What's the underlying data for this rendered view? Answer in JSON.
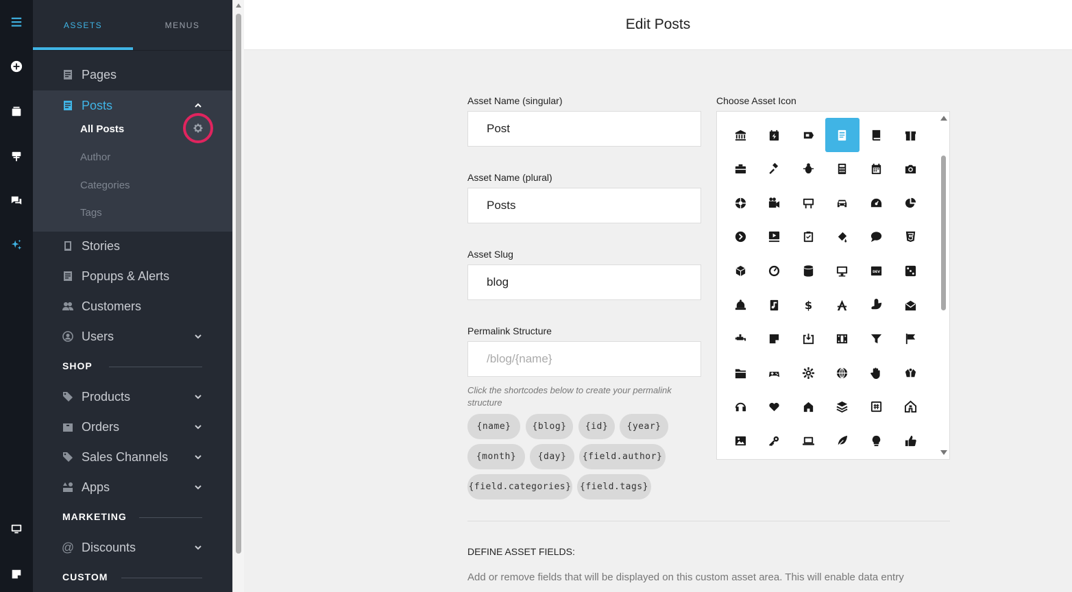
{
  "rail": {
    "items": [
      {
        "name": "menu-icon"
      },
      {
        "name": "add-icon"
      },
      {
        "name": "pages-icon"
      },
      {
        "name": "design-icon"
      },
      {
        "name": "chat-icon"
      },
      {
        "name": "magic-icon"
      },
      {
        "name": "desktop-icon"
      },
      {
        "name": "note-icon"
      }
    ],
    "accent": "#40b4e5"
  },
  "sidebar": {
    "tabs": [
      {
        "label": "ASSETS",
        "active": true
      },
      {
        "label": "MENUS",
        "active": false
      }
    ],
    "items": [
      {
        "label": "Pages",
        "icon": "page-icon"
      },
      {
        "label": "Posts",
        "icon": "post-icon",
        "active": true
      },
      {
        "label": "Stories",
        "icon": "story-icon"
      },
      {
        "label": "Popups & Alerts",
        "icon": "popup-icon"
      },
      {
        "label": "Customers",
        "icon": "customers-icon"
      },
      {
        "label": "Users",
        "icon": "user-icon"
      },
      {
        "label": "Products",
        "icon": "tag-icon"
      },
      {
        "label": "Orders",
        "icon": "box-icon"
      },
      {
        "label": "Sales Channels",
        "icon": "tag-icon"
      },
      {
        "label": "Apps",
        "icon": "apps-icon"
      },
      {
        "label": "Discounts",
        "icon": "at-icon"
      }
    ],
    "posts_sub": [
      {
        "label": "All Posts",
        "active": true
      },
      {
        "label": "Author"
      },
      {
        "label": "Categories"
      },
      {
        "label": "Tags"
      }
    ],
    "sections": {
      "shop": "SHOP",
      "marketing": "MARKETING",
      "custom": "CUSTOM"
    }
  },
  "header": {
    "title": "Edit Posts"
  },
  "form": {
    "singular_label": "Asset Name (singular)",
    "singular_value": "Post",
    "plural_label": "Asset Name (plural)",
    "plural_value": "Posts",
    "slug_label": "Asset Slug",
    "slug_value": "blog",
    "permalink_label": "Permalink Structure",
    "permalink_placeholder": "/blog/{name}",
    "hint": "Click the shortcodes below to create your permalink structure",
    "shortcodes": [
      "{name}",
      "{blog}",
      "{id}",
      "{year}",
      "{month}",
      "{day}",
      "{field.author}",
      "{field.categories}",
      "{field.tags}"
    ],
    "icon_label": "Choose Asset Icon",
    "define_title": "DEFINE ASSET FIELDS:",
    "define_desc": "Add or remove fields that will be displayed on this custom asset area. This will enable data entry"
  },
  "icons": [
    "university-icon",
    "calendar-plus-icon",
    "ticket-icon",
    "newspaper-icon",
    "book-icon",
    "gift-icon",
    "briefcase-icon",
    "gavel-icon",
    "bug-icon",
    "calculator-icon",
    "calendar-icon",
    "camera-icon",
    "aperture-icon",
    "video-icon",
    "chalkboard-icon",
    "car-icon",
    "tachometer-icon",
    "pie-chart-icon",
    "chevron-circle-icon",
    "tv-play-icon",
    "clipboard-check-icon",
    "paint-bucket-icon",
    "comment-icon",
    "css3-icon",
    "cube-icon",
    "dashboard-icon",
    "database-icon",
    "desktop-icon",
    "dev-icon",
    "dice-icon",
    "bell-icon",
    "music-file-icon",
    "dollar-icon",
    "drafting-icon",
    "duck-icon",
    "envelope-icon",
    "faucet-icon",
    "sticky-note-icon",
    "download-box-icon",
    "film-icon",
    "funnel-icon",
    "flag-icon",
    "folder-icon",
    "gamepad-icon",
    "gear-icon",
    "globe-icon",
    "hand-icon",
    "hands-icon",
    "headphones-icon",
    "heart-icon",
    "home-icon",
    "layers-icon",
    "keyboard-icon",
    "house-icon",
    "image-icon",
    "key-icon",
    "laptop-icon",
    "leaf-icon",
    "lightbulb-icon",
    "thumbs-up-icon"
  ],
  "selected_icon_index": 3
}
